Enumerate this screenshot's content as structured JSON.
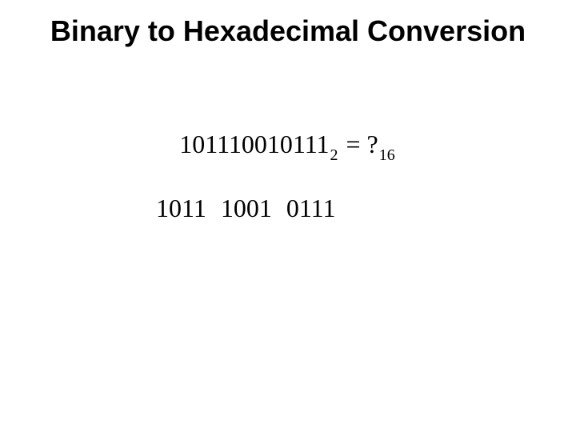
{
  "title": "Binary to Hexadecimal Conversion",
  "equation": {
    "binary_value": "101110010111",
    "binary_base": "2",
    "equals": " = ",
    "result_value": "?",
    "result_base": "16"
  },
  "grouped_line": "1011  1001  0111"
}
